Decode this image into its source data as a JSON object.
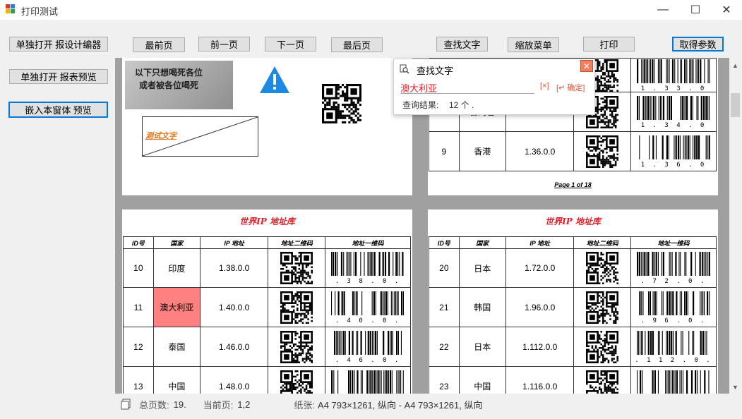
{
  "window": {
    "title": "打印测试",
    "minimize": "—",
    "maximize": "☐",
    "close": "✕"
  },
  "left_buttons": {
    "open_designer": "单独打开 报设计编器",
    "open_preview": "单独打开 报表预览",
    "embed_preview": "嵌入本窗体 预览"
  },
  "toolbar": {
    "first": "最前页",
    "prev": "前一页",
    "next": "下一页",
    "last": "最后页",
    "find": "查找文字",
    "zoom_menu": "缩放菜单",
    "print": "打印",
    "get_params": "取得参数"
  },
  "find_dialog": {
    "title": "查找文字",
    "query": "澳大利亚",
    "clear": "[×]",
    "confirm": "[↵ 确定]",
    "result_label": "查询结果:",
    "result_value": "12 个 ."
  },
  "page1": {
    "photo_text_1": "以下只想喝死各位",
    "photo_text_2": "或者被各位喝死",
    "sample_text": "测试文字",
    "rows": [
      {
        "id": "9",
        "country": "香港",
        "ip": "1.36.0.0",
        "barcode": "1.36.0"
      }
    ],
    "partial_rows": [
      {
        "barcode": "1.33.0"
      },
      {
        "id": "8",
        "country": "台湾省",
        "ip": "1.34.0.0",
        "barcode": "1.34.0"
      }
    ],
    "footer": "Page 1 of 18"
  },
  "report": {
    "title": "世界IP 地址库",
    "headers": [
      "ID号",
      "国家",
      "IP 地址",
      "地址二维码",
      "地址一维码"
    ]
  },
  "page2": {
    "rows": [
      {
        "id": "10",
        "country": "印度",
        "ip": "1.38.0.0",
        "barcode": "1.38.0.0"
      },
      {
        "id": "11",
        "country": "澳大利亚",
        "ip": "1.40.0.0",
        "barcode": "1.40.0.0",
        "highlight": true
      },
      {
        "id": "12",
        "country": "泰国",
        "ip": "1.46.0.0",
        "barcode": "1.46.0.0"
      },
      {
        "id": "13",
        "country": "中国",
        "ip": "1.48.0.0",
        "barcode": ""
      }
    ]
  },
  "page3": {
    "rows": [
      {
        "id": "20",
        "country": "日本",
        "ip": "1.72.0.0",
        "barcode": "1.72.0.0"
      },
      {
        "id": "21",
        "country": "韩国",
        "ip": "1.96.0.0",
        "barcode": "1.96.0.0"
      },
      {
        "id": "22",
        "country": "日本",
        "ip": "1.112.0.0",
        "barcode": "1.112.0.0"
      },
      {
        "id": "23",
        "country": "中国",
        "ip": "1.116.0.0",
        "barcode": ""
      }
    ]
  },
  "status": {
    "total_pages_label": "总页数:",
    "total_pages": "19.",
    "current_page_label": "当前页:",
    "current_page": "1,2",
    "paper_label": "纸张:",
    "paper": "A4  793×1261, 纵向  -  A4  793×1261, 纵向"
  },
  "colors": {
    "accent": "#0078d7",
    "highlight": "#ff8080",
    "report_title": "#e0202a",
    "warning": "#1e88e5"
  }
}
